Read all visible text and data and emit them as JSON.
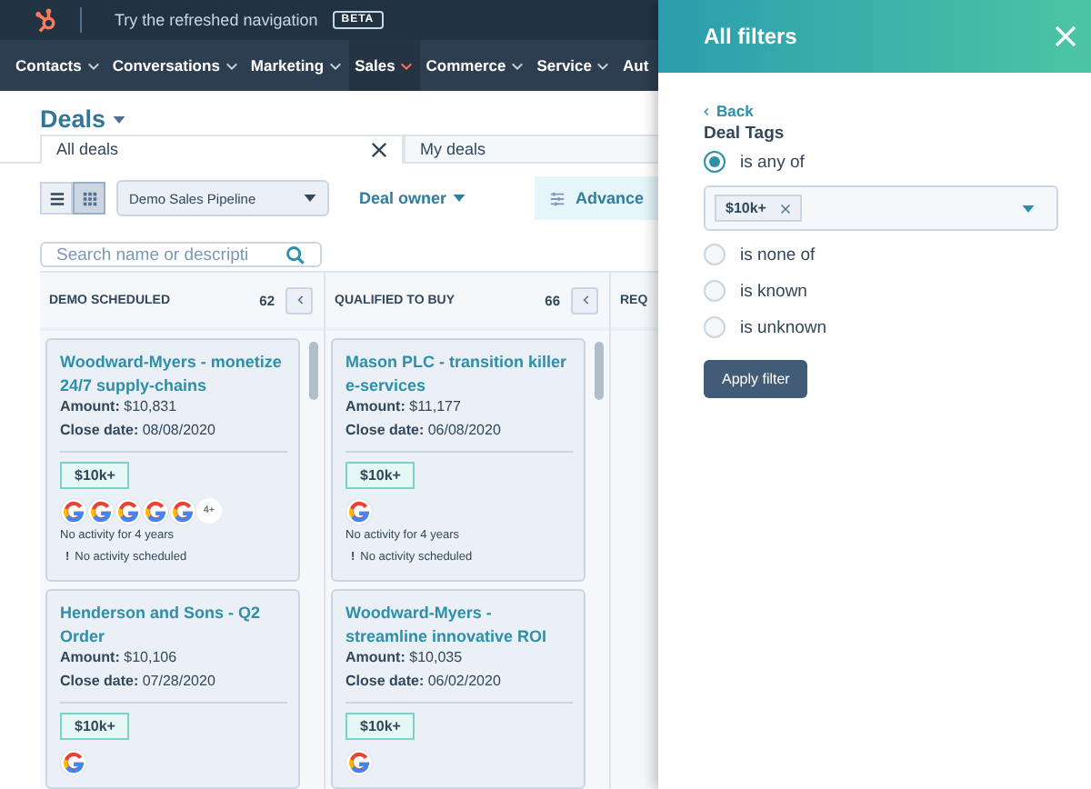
{
  "top_bar": {
    "refresh_text": "Try the refreshed navigation",
    "badge": "BETA"
  },
  "nav": [
    {
      "label": "Contacts",
      "selected": false
    },
    {
      "label": "Conversations",
      "selected": false
    },
    {
      "label": "Marketing",
      "selected": false
    },
    {
      "label": "Sales",
      "selected": true
    },
    {
      "label": "Commerce",
      "selected": false
    },
    {
      "label": "Service",
      "selected": false
    },
    {
      "label": "Aut",
      "selected": false
    }
  ],
  "page": {
    "title": "Deals",
    "view_tabs": [
      {
        "label": "All deals",
        "selected": true,
        "closable": true
      },
      {
        "label": "My deals",
        "selected": false,
        "closable": false
      }
    ],
    "view_toggle": [
      {
        "kind": "list",
        "selected": false
      },
      {
        "kind": "board",
        "selected": true
      }
    ],
    "pipeline": "Demo Sales Pipeline",
    "deal_owner": "Deal owner",
    "advanced": "Advance",
    "search": {
      "placeholder": "Search name or descripti"
    }
  },
  "columns": [
    {
      "title": "DEMO SCHEDULED",
      "count": "62",
      "cards": [
        {
          "title": "Woodward-Myers - monetize 24/7 supply-chains",
          "amount_label": "Amount:",
          "amount": "$10,831",
          "close_label": "Close date:",
          "close_date": "08/08/2020",
          "tag": "$10k+",
          "avatars": [
            {
              "kind": "google"
            },
            {
              "kind": "google"
            },
            {
              "kind": "google"
            },
            {
              "kind": "google"
            },
            {
              "kind": "google"
            }
          ],
          "more": "4+",
          "activity": "No activity for 4 years",
          "mark": "!",
          "scheduled": "No activity scheduled"
        },
        {
          "title": "Henderson and Sons - Q2 Order",
          "amount_label": "Amount:",
          "amount": "$10,106",
          "close_label": "Close date:",
          "close_date": "07/28/2020",
          "tag": "$10k+",
          "avatars": [
            {
              "kind": "google"
            }
          ]
        }
      ]
    },
    {
      "title": "QUALIFIED TO BUY",
      "count": "66",
      "cards": [
        {
          "title": "Mason PLC - transition killer e-services",
          "amount_label": "Amount:",
          "amount": "$11,177",
          "close_label": "Close date:",
          "close_date": "06/08/2020",
          "tag": "$10k+",
          "avatars": [
            {
              "kind": "google"
            }
          ],
          "activity": "No activity for 4 years",
          "mark": "!",
          "scheduled": "No activity scheduled"
        },
        {
          "title": "Woodward-Myers - streamline innovative ROI",
          "amount_label": "Amount:",
          "amount": "$10,035",
          "close_label": "Close date:",
          "close_date": "06/02/2020",
          "tag": "$10k+",
          "avatars": [
            {
              "kind": "google"
            }
          ]
        }
      ]
    },
    {
      "title": "REQ"
    }
  ],
  "panel": {
    "title": "All filters",
    "back": "Back",
    "heading": "Deal Tags",
    "options": [
      {
        "label": "is any of",
        "selected": true,
        "chips": [
          {
            "label": "$10k+"
          }
        ]
      },
      {
        "label": "is none of",
        "selected": false
      },
      {
        "label": "is known",
        "selected": false
      },
      {
        "label": "is unknown",
        "selected": false
      }
    ],
    "apply": "Apply filter"
  }
}
